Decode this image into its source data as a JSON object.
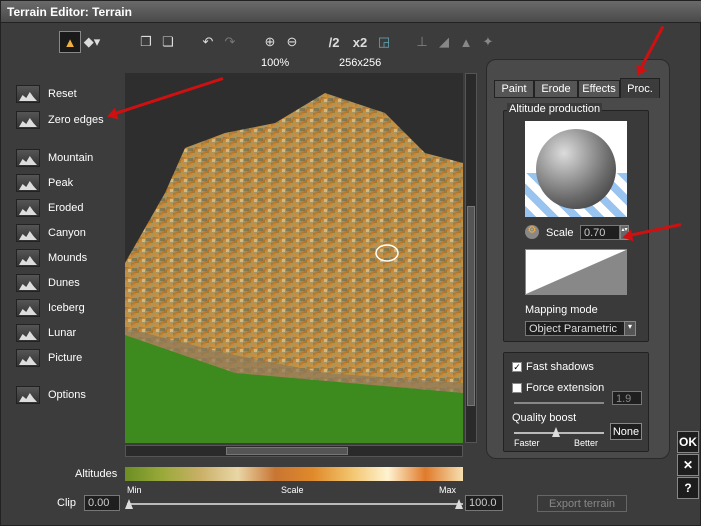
{
  "window": {
    "title": "Terrain Editor: Terrain"
  },
  "toolbar": {
    "zoom_level": "100%",
    "resolution": "256x256",
    "res_halve": "/2",
    "res_double": "x2"
  },
  "left_panel": {
    "items": [
      "Reset",
      "Zero edges",
      "Mountain",
      "Peak",
      "Eroded",
      "Canyon",
      "Mounds",
      "Dunes",
      "Iceberg",
      "Lunar",
      "Picture",
      "Options"
    ]
  },
  "bottom": {
    "altitudes_label": "Altitudes",
    "scale_min": "Min",
    "scale_label": "Scale",
    "scale_max": "Max",
    "clip_label": "Clip",
    "clip_min": "0.00",
    "clip_max": "100.0",
    "export_button": "Export terrain"
  },
  "tabs": [
    "Paint",
    "Erode",
    "Effects",
    "Proc."
  ],
  "altitude_production": {
    "title": "Altitude production",
    "scale_label": "Scale",
    "scale_value": "0.70",
    "mapping_label": "Mapping mode",
    "mapping_value": "Object Parametric"
  },
  "options": {
    "fast_shadows": "Fast shadows",
    "force_extension": "Force extension",
    "force_value": "1.9",
    "quality_label": "Quality boost",
    "faster": "Faster",
    "better": "Better",
    "none_button": "None"
  },
  "side_buttons": {
    "ok": "OK",
    "cancel": "✕",
    "help": "?"
  },
  "colors": {
    "accent": "#f0b040",
    "arrow": "#d01010"
  }
}
